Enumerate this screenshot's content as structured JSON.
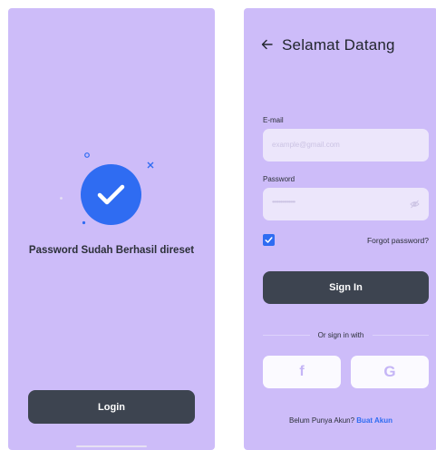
{
  "left_screen": {
    "success_message": "Password Sudah Berhasil direset",
    "login_label": "Login"
  },
  "right_screen": {
    "title": "Selamat Datang",
    "email_label": "E-mail",
    "email_placeholder": "example@gmail.com",
    "password_label": "Password",
    "password_placeholder": "••••••••••••••",
    "remember_checked": true,
    "forgot_label": "Forgot password?",
    "signin_label": "Sign In",
    "divider_text": "Or sign in with",
    "social": {
      "facebook_glyph": "f",
      "google_glyph": "G"
    },
    "footer_prompt": "Belum Punya Akun?",
    "footer_link": "Buat Akun"
  },
  "colors": {
    "background_purple": "#cdbcf9",
    "primary_blue": "#2f6cf2",
    "dark_button": "#3d4450",
    "field_fill": "#ece6fb"
  }
}
